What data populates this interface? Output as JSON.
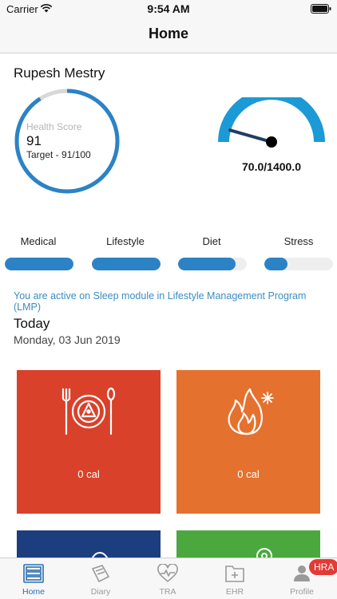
{
  "status": {
    "carrier": "Carrier",
    "time": "9:54 AM"
  },
  "nav": {
    "title": "Home"
  },
  "user": {
    "name": "Rupesh Mestry"
  },
  "health_score": {
    "label": "Health Score",
    "value": "91",
    "target_text": "Target - 91/100",
    "fraction": 0.91
  },
  "gauge": {
    "value_text": "70.0/1400.0",
    "value": 70.0,
    "max": 1400.0
  },
  "categories": [
    {
      "label": "Medical",
      "fraction": 1.0
    },
    {
      "label": "Lifestyle",
      "fraction": 1.0
    },
    {
      "label": "Diet",
      "fraction": 0.84
    },
    {
      "label": "Stress",
      "fraction": 0.34
    }
  ],
  "module_note": "You are active on Sleep module in Lifestyle Management Program (LMP)",
  "today": {
    "title": "Today",
    "date": "Monday, 03 Jun 2019"
  },
  "tiles": [
    {
      "value": "0 cal",
      "icon": "food-plate-icon",
      "color": "#d9412a"
    },
    {
      "value": "0 cal",
      "icon": "flame-icon",
      "color": "#e5712f"
    },
    {
      "value": "",
      "icon": "egg-icon",
      "color": "#1c3e7f"
    },
    {
      "value": "",
      "icon": "target-icon",
      "color": "#4aa83f"
    }
  ],
  "tabs": [
    {
      "label": "Home",
      "icon": "home-list-icon",
      "active": true
    },
    {
      "label": "Diary",
      "icon": "diary-icon",
      "active": false
    },
    {
      "label": "TRA",
      "icon": "heart-rate-icon",
      "active": false
    },
    {
      "label": "EHR",
      "icon": "health-record-icon",
      "active": false
    },
    {
      "label": "Profile",
      "icon": "profile-icon",
      "active": false
    }
  ],
  "hra_badge": "HRA",
  "colors": {
    "accent": "#2b83c6",
    "gauge": "#1b9ad6",
    "link": "#3a8dc4"
  }
}
